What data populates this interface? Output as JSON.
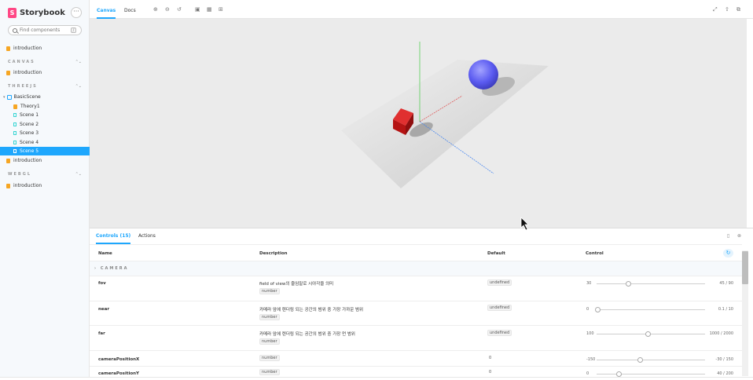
{
  "app": {
    "name": "Storybook"
  },
  "sidebar": {
    "search_placeholder": "Find components",
    "search_key": "/",
    "menu_glyph": "···",
    "root_item": "introduction",
    "sections": [
      {
        "title": "CANVAS",
        "items": [
          {
            "label": "introduction"
          }
        ]
      },
      {
        "title": "THREEJS",
        "component": "BasicScene",
        "items": [
          {
            "label": "Theory1"
          },
          {
            "label": "Scene 1"
          },
          {
            "label": "Scene 2"
          },
          {
            "label": "Scene 3"
          },
          {
            "label": "Scene 4"
          },
          {
            "label": "Scene 5"
          }
        ],
        "extra": "introduction"
      },
      {
        "title": "WEBGL",
        "items": [
          {
            "label": "introduction"
          }
        ]
      }
    ],
    "selected": "Scene 5"
  },
  "toolbar": {
    "tabs": [
      {
        "label": "Canvas"
      },
      {
        "label": "Docs"
      }
    ],
    "active_tab": "Canvas",
    "tools": [
      "zoom-in-icon",
      "zoom-out-icon",
      "zoom-reset-icon",
      "background-icon",
      "grid-icon",
      "measure-icon"
    ],
    "right_tools": [
      "fullscreen-icon",
      "share-icon",
      "new-tab-icon"
    ]
  },
  "panel": {
    "tabs": [
      {
        "label": "Controls (15)"
      },
      {
        "label": "Actions"
      }
    ],
    "active_tab": "Controls (15)",
    "headers": {
      "name": "Name",
      "description": "Description",
      "default": "Default",
      "control": "Control"
    },
    "category": "CAMERA",
    "rows": [
      {
        "name": "fov",
        "description": "field of view의 줄임말로 시야각을 의미",
        "type": "number",
        "default": "undefined",
        "min": "30",
        "max": "45 / 90",
        "value": 45
      },
      {
        "name": "near",
        "description": "카메라 앞에 렌더링 되는 공간의 범위 중 가장 가까운 범위",
        "type": "number",
        "default": "undefined",
        "min": "0",
        "max": "0.1 / 10",
        "value": 0.1
      },
      {
        "name": "far",
        "description": "카메라 앞에 렌더링 되는 공간의 범위 중 가장 먼 범위",
        "type": "number",
        "default": "undefined",
        "min": "100",
        "max": "1000 / 2000",
        "value": 1000
      },
      {
        "name": "cameraPositionX",
        "description": "",
        "type": "number",
        "default": "0",
        "min": "-150",
        "max": "-30 / 150",
        "value": -30
      },
      {
        "name": "cameraPositionY",
        "description": "",
        "type": "number",
        "default": "0",
        "min": "0",
        "max": "40 / 200",
        "value": 40
      }
    ]
  },
  "scene": {
    "ground_color": "#dedede",
    "cube_color": "#cc1111",
    "sphere_color": "#6b6bff",
    "bg_color": "#ebebeb"
  }
}
